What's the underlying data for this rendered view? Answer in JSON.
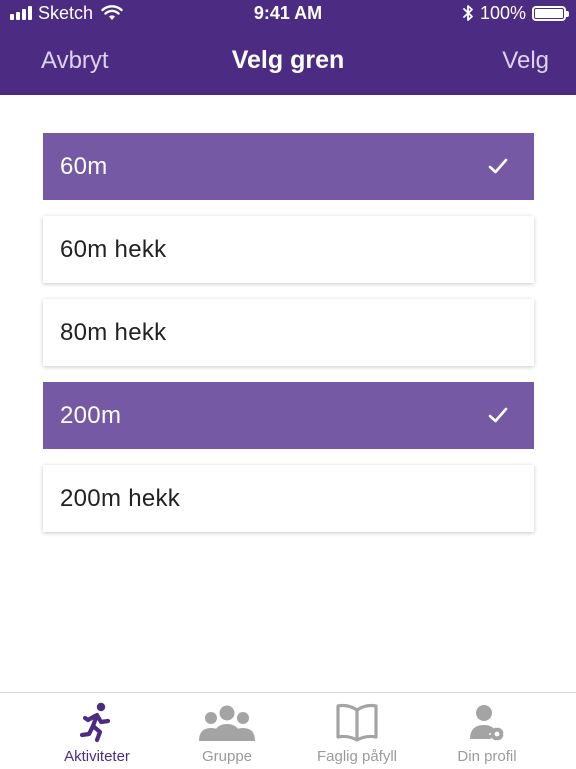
{
  "status_bar": {
    "carrier": "Sketch",
    "time": "9:41 AM",
    "battery_percent": "100%",
    "battery_level": 1.0,
    "icons": [
      "signal-icon",
      "wifi-icon",
      "bluetooth-icon",
      "battery-icon"
    ]
  },
  "nav": {
    "cancel_label": "Avbryt",
    "title": "Velg gren",
    "confirm_label": "Velg"
  },
  "options": [
    {
      "label": "60m",
      "selected": true
    },
    {
      "label": "60m hekk",
      "selected": false
    },
    {
      "label": "80m hekk",
      "selected": false
    },
    {
      "label": "200m",
      "selected": true
    },
    {
      "label": "200m hekk",
      "selected": false
    }
  ],
  "tabs": [
    {
      "label": "Aktiviteter",
      "icon": "runner-icon",
      "active": true
    },
    {
      "label": "Gruppe",
      "icon": "group-icon",
      "active": false
    },
    {
      "label": "Faglig påfyll",
      "icon": "book-icon",
      "active": false
    },
    {
      "label": "Din profil",
      "icon": "profile-settings-icon",
      "active": false
    }
  ],
  "colors": {
    "brand": "#4c2c83",
    "selected_row": "#7559a4",
    "inactive_tab": "#9b9b9b",
    "nav_button_text": "#dcd3ee"
  }
}
